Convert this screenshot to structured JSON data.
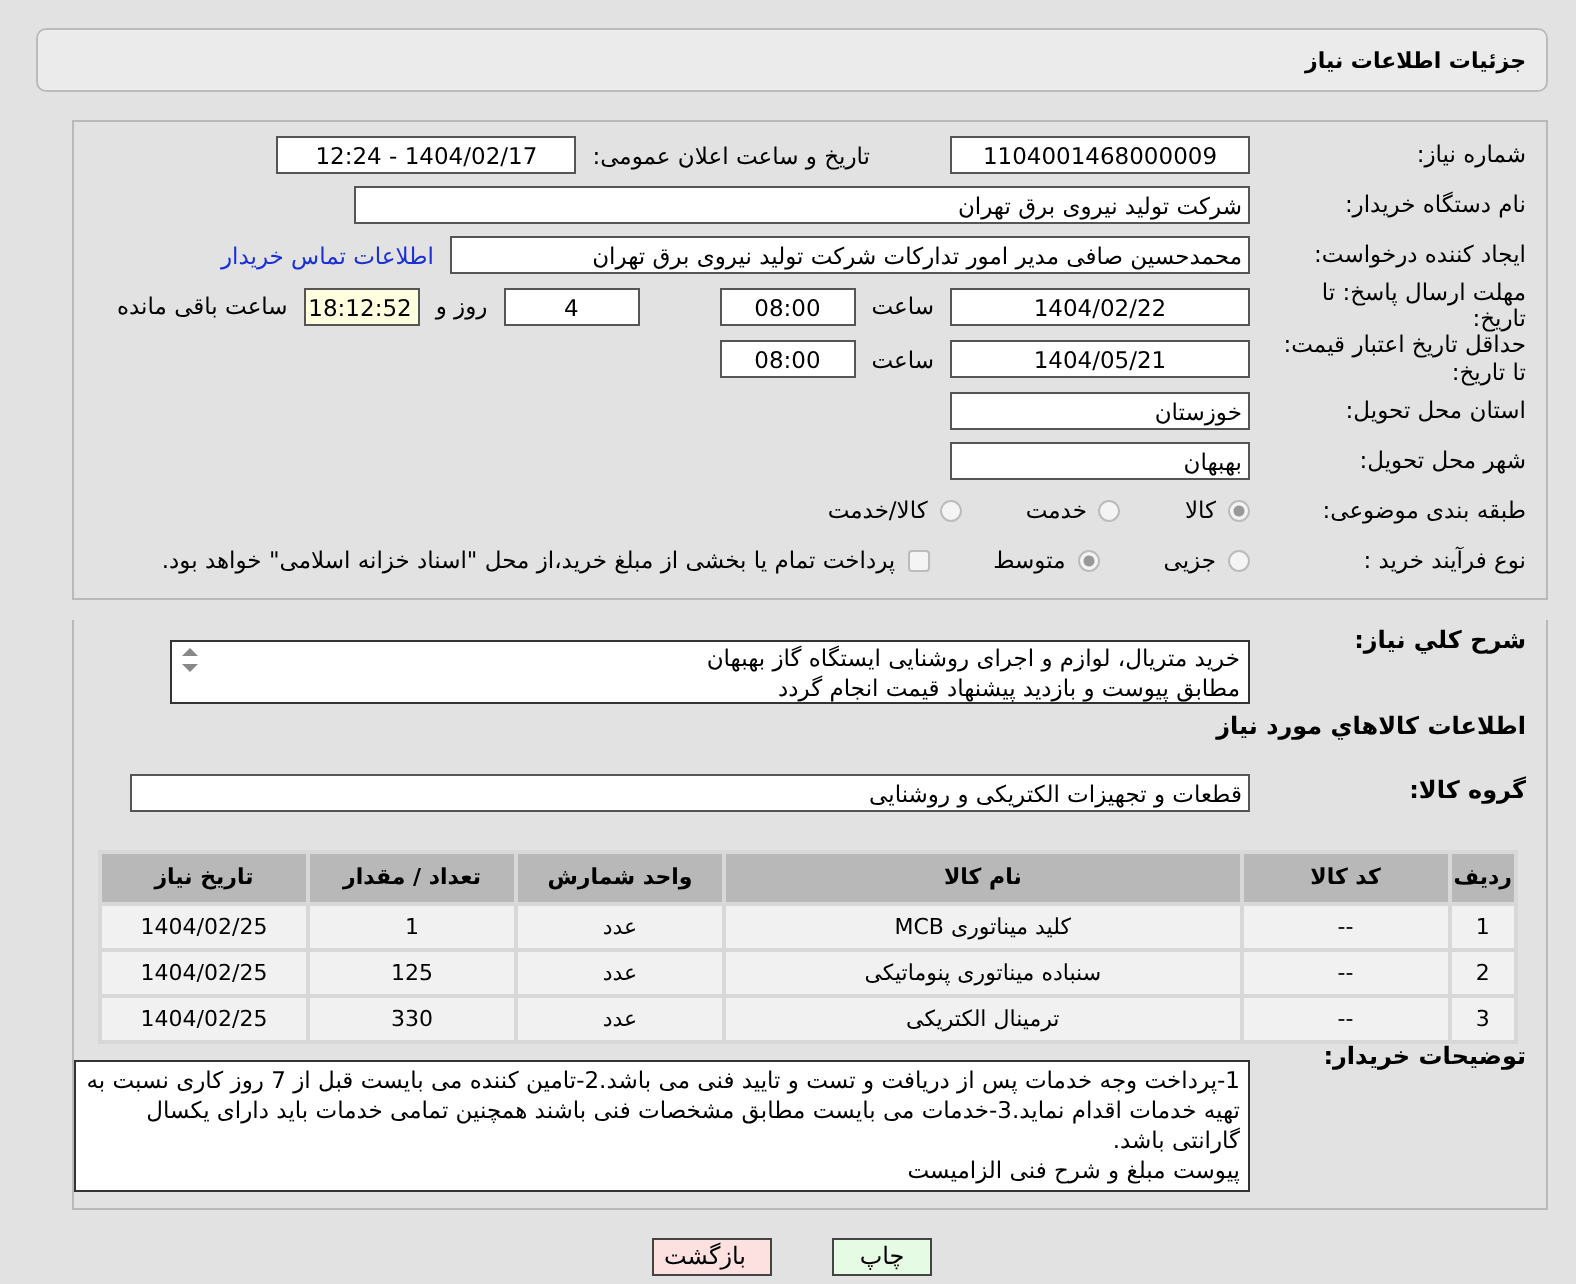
{
  "header": {
    "title": "جزئیات اطلاعات نیاز"
  },
  "need_number": {
    "label": "شماره نیاز:",
    "value": "1104001468000009"
  },
  "announce": {
    "label": "تاریخ و ساعت اعلان عمومی:",
    "value": "1404/02/17 - 12:24"
  },
  "buyer": {
    "label": "نام دستگاه خریدار:",
    "value": "شرکت تولید نیروی برق تهران"
  },
  "requester": {
    "label": "ایجاد کننده درخواست:",
    "value": "محمدحسین صافی مدیر امور تدارکات شرکت تولید نیروی برق تهران",
    "link": "اطلاعات تماس خریدار"
  },
  "deadline": {
    "label": "مهلت ارسال پاسخ: تا تاریخ:",
    "date": "1404/02/22",
    "time_label": "ساعت",
    "time": "08:00",
    "days": "4",
    "days_label": "روز و",
    "remaining": "18:12:52",
    "remaining_label": "ساعت باقی مانده"
  },
  "validity": {
    "label": "حداقل تاریخ اعتبار قیمت: تا تاریخ:",
    "date": "1404/05/21",
    "time_label": "ساعت",
    "time": "08:00"
  },
  "province": {
    "label": "استان محل تحویل:",
    "value": "خوزستان"
  },
  "city": {
    "label": "شهر محل تحویل:",
    "value": "بهبهان"
  },
  "category": {
    "label": "طبقه بندی موضوعی:",
    "options": [
      {
        "label": "کالا",
        "selected": true
      },
      {
        "label": "خدمت",
        "selected": false
      },
      {
        "label": "کالا/خدمت",
        "selected": false
      }
    ]
  },
  "process": {
    "label": "نوع فرآیند خرید :",
    "options": [
      {
        "label": "جزیی",
        "selected": false
      },
      {
        "label": "متوسط",
        "selected": true
      }
    ],
    "treasury": {
      "checked": false,
      "text": "پرداخت تمام یا بخشی از مبلغ خرید،از محل \"اسناد خزانه اسلامی\" خواهد بود."
    }
  },
  "description": {
    "label": "شرح کلي نياز:",
    "value": "خرید متریال، لوازم و اجرای روشنایی ایستگاه گاز بهبهان\nمطابق پیوست و بازدید پیشنهاد قیمت انجام گردد"
  },
  "goods_title": "اطلاعات کالاهاي مورد نياز",
  "group": {
    "label": "گروه کالا:",
    "value": "قطعات و تجهیزات الکتریکی و روشنایی"
  },
  "table": {
    "columns": [
      "ردیف",
      "کد کالا",
      "نام کالا",
      "واحد شمارش",
      "تعداد / مقدار",
      "تاریخ نیاز"
    ],
    "rows": [
      [
        "1",
        "--",
        "کلید میناتوری MCB",
        "عدد",
        "1",
        "1404/02/25"
      ],
      [
        "2",
        "--",
        "سنباده میناتوری پنوماتیکی",
        "عدد",
        "125",
        "1404/02/25"
      ],
      [
        "3",
        "--",
        "ترمینال الکتریکی",
        "عدد",
        "330",
        "1404/02/25"
      ]
    ]
  },
  "notes": {
    "label": "توضیحات خریدار:",
    "value": "1-پرداخت وجه خدمات پس از دریافت و تست و تایید فنی می باشد.2-تامین کننده می بایست قبل از 7 روز کاری نسبت به تهیه خدمات اقدام نماید.3-خدمات می بایست مطابق مشخصات فنی باشند همچنین تمامی خدمات باید دارای یکسال گارانتی باشد.\nپیوست مبلغ و شرح فنی الزامیست"
  },
  "buttons": [
    {
      "label": "چاپ",
      "kind": "print"
    },
    {
      "label": "بازگشت",
      "kind": "back"
    }
  ]
}
